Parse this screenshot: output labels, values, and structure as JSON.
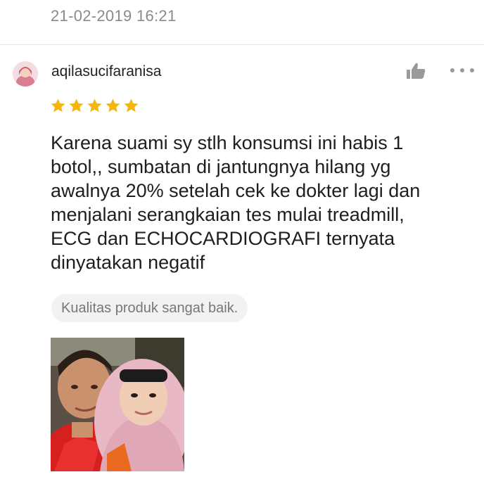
{
  "timestamp": "21-02-2019 16:21",
  "review": {
    "username": "aqilasucifaranisa",
    "rating": 5,
    "rating_max": 5,
    "star_color": "#f5b50a",
    "text_lines": [
      "Karena suami sy stlh konsumsi ini habis 1",
      "botol,, sumbatan di jantungnya hilang yg",
      "awalnya 20% setelah cek ke dokter lagi dan",
      "menjalani serangkaian tes mulai treadmill,",
      "ECG dan ECHOCARDIOGRAFI ternyata",
      "dinyatakan negatif"
    ],
    "quality_tag": "Kualitas produk sangat baik."
  },
  "icons": {
    "like": "thumbs-up-icon",
    "more": "more-options-icon",
    "star": "star-icon"
  }
}
